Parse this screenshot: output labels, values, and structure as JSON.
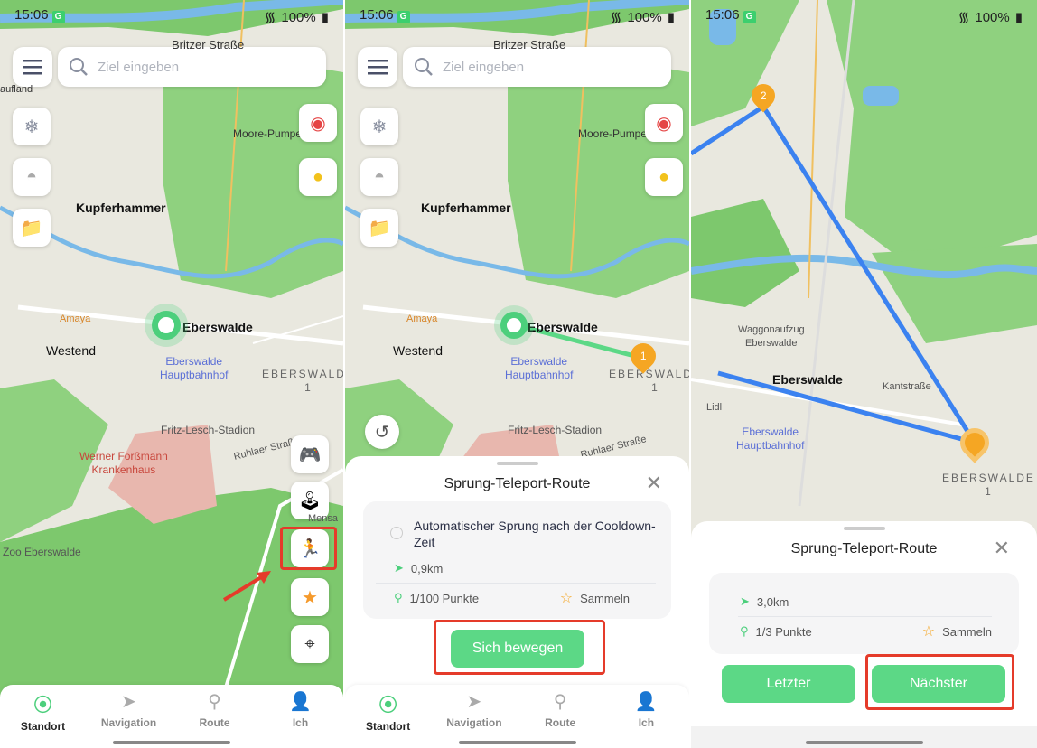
{
  "status": {
    "time": "15:06",
    "battery": "100%"
  },
  "search": {
    "placeholder": "Ziel eingeben"
  },
  "map": {
    "britzer": "Britzer Straße",
    "aufland": "aufland",
    "moore": "Moore-Pumpe",
    "kupferhammer": "Kupferhammer",
    "amaya": "Amaya",
    "eberswalde": "Eberswalde",
    "westend": "Westend",
    "hbf1": "Eberswalde",
    "hbf2": "Hauptbahnhof",
    "district": "EBERSWALDE",
    "district_num": "1",
    "stadion": "Fritz-Lesch-Stadion",
    "ruhlaer": "Ruhlaer Straße",
    "klinik1": "Werner Forßmann",
    "klinik2": "Krankenhaus",
    "mensa": "Mensa",
    "zoo": "Zoo Eberswalde",
    "waggon1": "Waggonaufzug",
    "waggon2": "Eberswalde",
    "kantstr": "Kantstraße",
    "lidl": "Lidl",
    "marker1": "1",
    "marker2": "2"
  },
  "tabs": [
    {
      "label": "Standort",
      "icon": "location-pin-icon"
    },
    {
      "label": "Navigation",
      "icon": "navigation-arrow-icon"
    },
    {
      "label": "Route",
      "icon": "route-icon"
    },
    {
      "label": "Ich",
      "icon": "person-icon"
    }
  ],
  "sheet2": {
    "title": "Sprung-Teleport-Route",
    "auto_jump": "Automatischer Sprung nach der Cooldown-Zeit",
    "distance": "0,9km",
    "points": "1/100 Punkte",
    "collect": "Sammeln",
    "move_button": "Sich bewegen"
  },
  "sheet3": {
    "title": "Sprung-Teleport-Route",
    "distance": "3,0km",
    "points": "1/3 Punkte",
    "collect": "Sammeln",
    "prev_button": "Letzter",
    "next_button": "Nächster"
  },
  "colors": {
    "accent": "#5cd886",
    "highlight": "#e53b2a",
    "route_line": "#3b82f0",
    "marker": "#f5a623"
  }
}
